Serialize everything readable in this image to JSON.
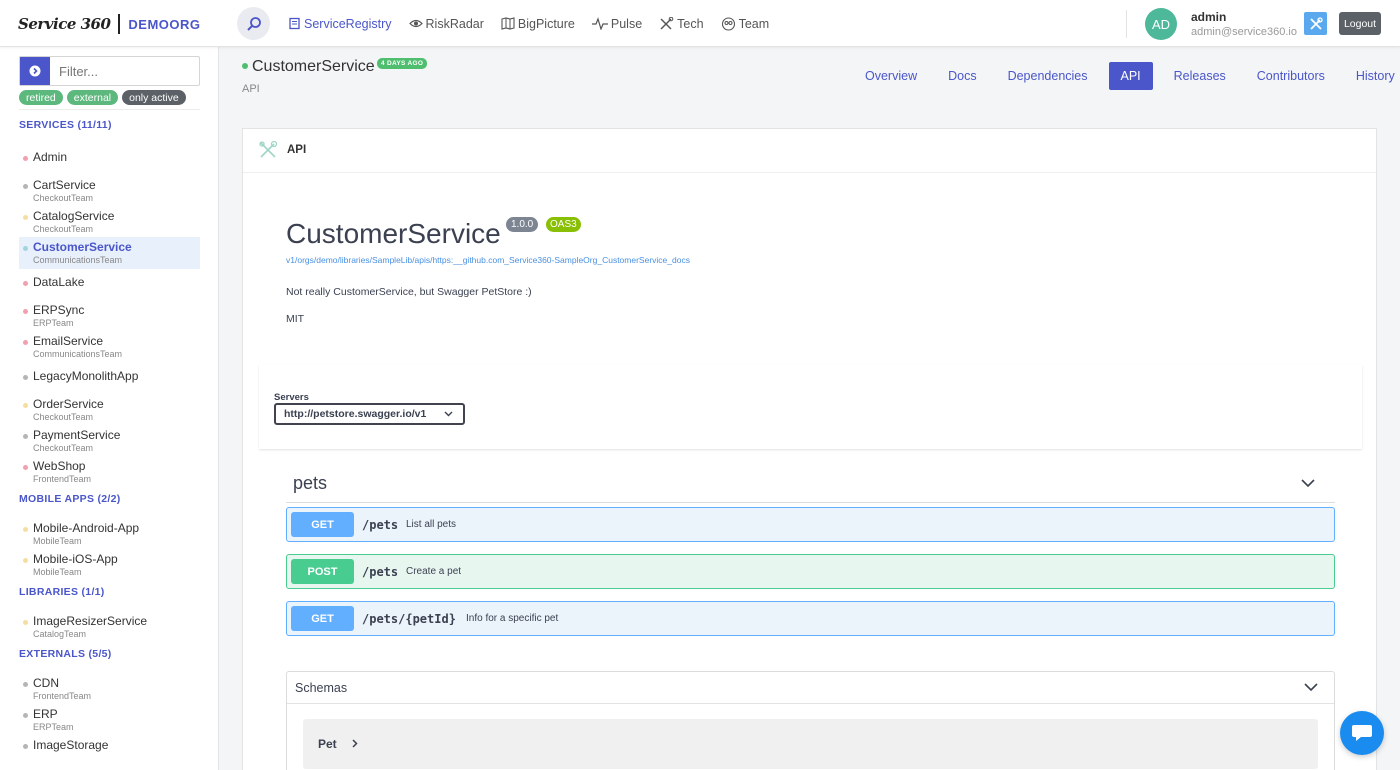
{
  "header": {
    "logo_text": "Service 360",
    "org": "DEMOORG",
    "nav": [
      {
        "label": "ServiceRegistry",
        "icon": "registry-icon"
      },
      {
        "label": "RiskRadar",
        "icon": "eye-icon"
      },
      {
        "label": "BigPicture",
        "icon": "map-icon"
      },
      {
        "label": "Pulse",
        "icon": "pulse-icon"
      },
      {
        "label": "Tech",
        "icon": "tools-icon"
      },
      {
        "label": "Team",
        "icon": "team-icon"
      }
    ],
    "user": {
      "initials": "AD",
      "name": "admin",
      "email": "admin@service360.io"
    },
    "logout_label": "Logout"
  },
  "sidebar": {
    "filter_placeholder": "Filter...",
    "chips": [
      "retired",
      "external",
      "only active"
    ],
    "sections": {
      "services": "SERVICES (11/11)",
      "mobile": "MOBILE APPS (2/2)",
      "libraries": "LIBRARIES (1/1)",
      "externals": "EXTERNALS (5/5)"
    },
    "services": [
      {
        "name": "Admin",
        "team": "",
        "color": "#f2a0b0"
      },
      {
        "name": "CartService",
        "team": "CheckoutTeam",
        "color": "#b5b5b5"
      },
      {
        "name": "CatalogService",
        "team": "CheckoutTeam",
        "color": "#f5dea0"
      },
      {
        "name": "CustomerService",
        "team": "CommunicationsTeam",
        "color": "#9fd6dd"
      },
      {
        "name": "DataLake",
        "team": "",
        "color": "#f2a0b0"
      },
      {
        "name": "ERPSync",
        "team": "ERPTeam",
        "color": "#f2a0b0"
      },
      {
        "name": "EmailService",
        "team": "CommunicationsTeam",
        "color": "#f2a0b0"
      },
      {
        "name": "LegacyMonolithApp",
        "team": "",
        "color": "#b5b5b5"
      },
      {
        "name": "OrderService",
        "team": "CheckoutTeam",
        "color": "#f5dea0"
      },
      {
        "name": "PaymentService",
        "team": "CheckoutTeam",
        "color": "#b5b5b5"
      },
      {
        "name": "WebShop",
        "team": "FrontendTeam",
        "color": "#f2a0b0"
      }
    ],
    "mobile": [
      {
        "name": "Mobile-Android-App",
        "team": "MobileTeam",
        "color": "#f5dea0"
      },
      {
        "name": "Mobile-iOS-App",
        "team": "MobileTeam",
        "color": "#f5dea0"
      }
    ],
    "libraries": [
      {
        "name": "ImageResizerService",
        "team": "CatalogTeam",
        "color": "#f5dea0"
      }
    ],
    "externals": [
      {
        "name": "CDN",
        "team": "FrontendTeam",
        "color": "#b5b5b5"
      },
      {
        "name": "ERP",
        "team": "ERPTeam",
        "color": "#b5b5b5"
      },
      {
        "name": "ImageStorage",
        "team": "",
        "color": "#b5b5b5"
      }
    ]
  },
  "page": {
    "title": "CustomerService",
    "badge": "4 DAYS AGO",
    "subtitle": "API",
    "tabs": [
      "Overview",
      "Docs",
      "Dependencies",
      "API",
      "Releases",
      "Contributors",
      "History"
    ]
  },
  "card": {
    "label": "API",
    "api_title": "CustomerService",
    "version": "1.0.0",
    "oas": "OAS3",
    "url": "v1/orgs/demo/libraries/SampleLib/apis/https:__github.com_Service360-SampleOrg_CustomerService_docs",
    "description": "Not really CustomerService, but Swagger PetStore :)",
    "license": "MIT",
    "servers_label": "Servers",
    "server_value": "http://petstore.swagger.io/v1",
    "tag": "pets",
    "operations": [
      {
        "method": "GET",
        "path": "/pets",
        "summary": "List all pets"
      },
      {
        "method": "POST",
        "path": "/pets",
        "summary": "Create a pet"
      },
      {
        "method": "GET",
        "path": "/pets/{petId}",
        "summary": "Info for a specific pet"
      }
    ],
    "schemas_label": "Schemas",
    "model_name": "Pet"
  }
}
